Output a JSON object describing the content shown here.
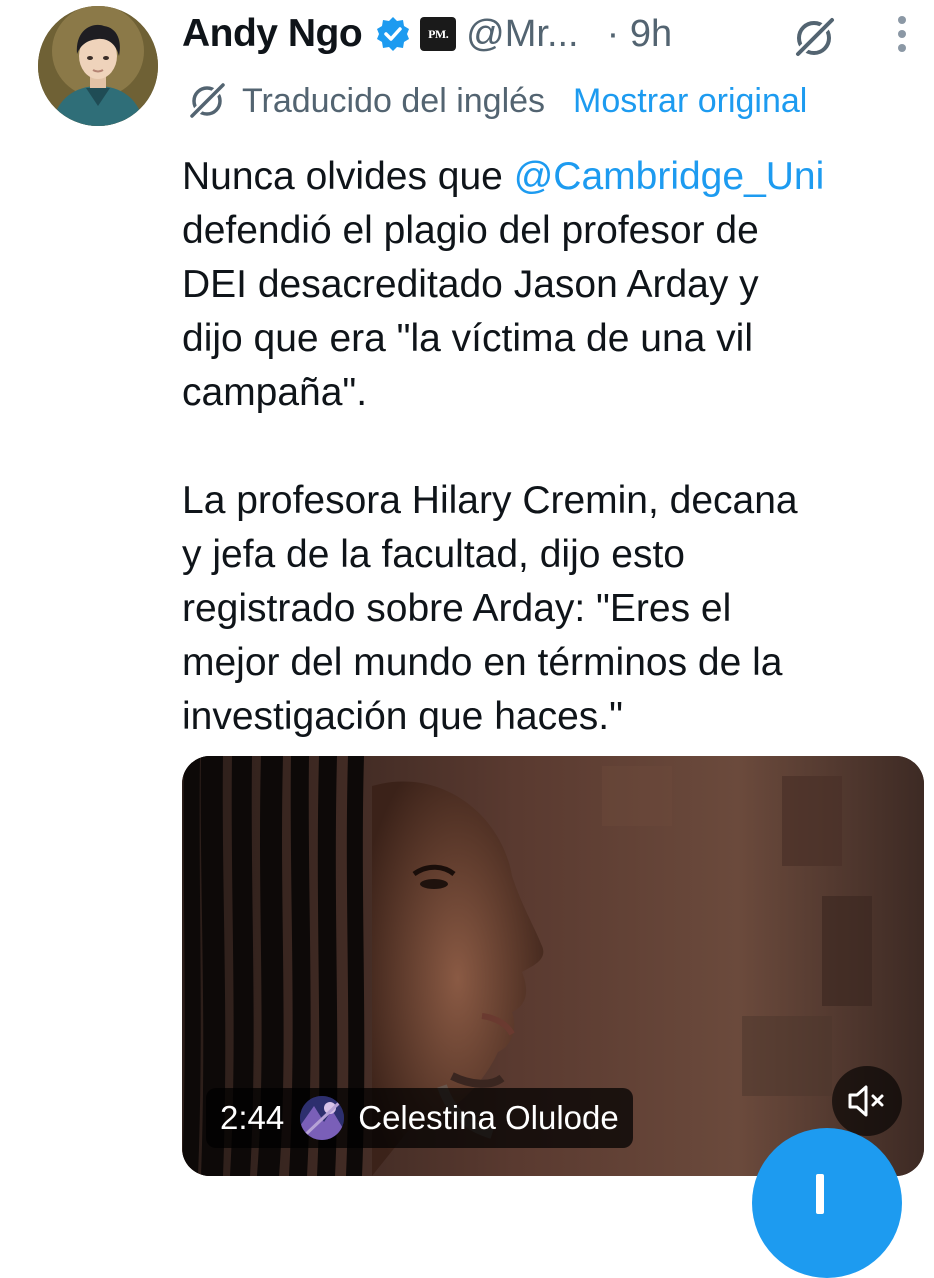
{
  "tweet": {
    "author": {
      "display_name": "Andy Ngo",
      "handle": "@Mr...",
      "badge_text": "PM.",
      "verified": true
    },
    "time": "· 9h",
    "translation": {
      "label": "Traducido del inglés",
      "show_original": "Mostrar original"
    },
    "text": {
      "p1_l1_prefix": "Nunca olvides que ",
      "p1_l1_mention": "@Cambridge_Uni",
      "p1_l2": "defendió el plagio del profesor de",
      "p1_l3": "DEI desacreditado Jason Arday y",
      "p1_l4": "dijo que era \"la víctima de una vil",
      "p1_l5": "campaña\".",
      "p2_l1": "La profesora Hilary Cremin, decana",
      "p2_l2": "y jefa de la facultad, dijo esto",
      "p2_l3": "registrado sobre Arday: \"Eres el",
      "p2_l4": "mejor del mundo en términos de la",
      "p2_l5": "investigación que haces.\""
    },
    "video": {
      "duration": "2:44",
      "channel_name": "Celestina Olulode",
      "muted": true
    }
  },
  "icons": {
    "verified": "verified-badge-icon",
    "grok": "grok-icon",
    "more": "more-vertical-icon",
    "translate": "translate-icon",
    "mute": "speaker-muted-icon",
    "compose": "plus-icon"
  },
  "colors": {
    "accent": "#1d9bf0",
    "text": "#0f1419",
    "secondary_text": "#536471"
  }
}
